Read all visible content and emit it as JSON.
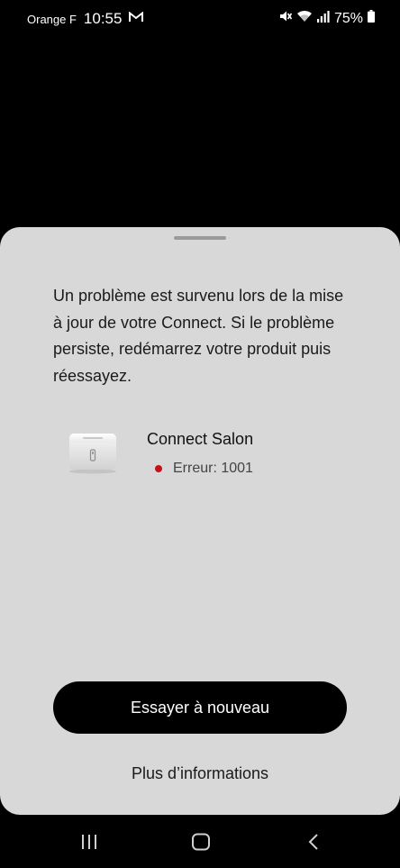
{
  "status_bar": {
    "carrier": "Orange F",
    "time": "10:55",
    "battery": "75%",
    "icons": [
      "gmail-icon",
      "mute-icon",
      "wifi-icon",
      "signal-icon",
      "battery-icon"
    ]
  },
  "sheet": {
    "message": "Un problème est survenu lors de la mise à jour de votre Connect. Si le problème persiste, redémarrez votre produit puis réessayez.",
    "device": {
      "name": "Connect Salon",
      "error": "Erreur: 1001",
      "status_color": "#c4111c"
    },
    "primary_button": "Essayer à nouveau",
    "secondary_link": "Plus d’informations"
  },
  "nav_bar": {
    "buttons": [
      "recents-icon",
      "home-icon",
      "back-icon"
    ]
  },
  "colors": {
    "sheet_background": "#d8d8d8",
    "button_background": "#000000",
    "error_dot": "#c4111c"
  }
}
